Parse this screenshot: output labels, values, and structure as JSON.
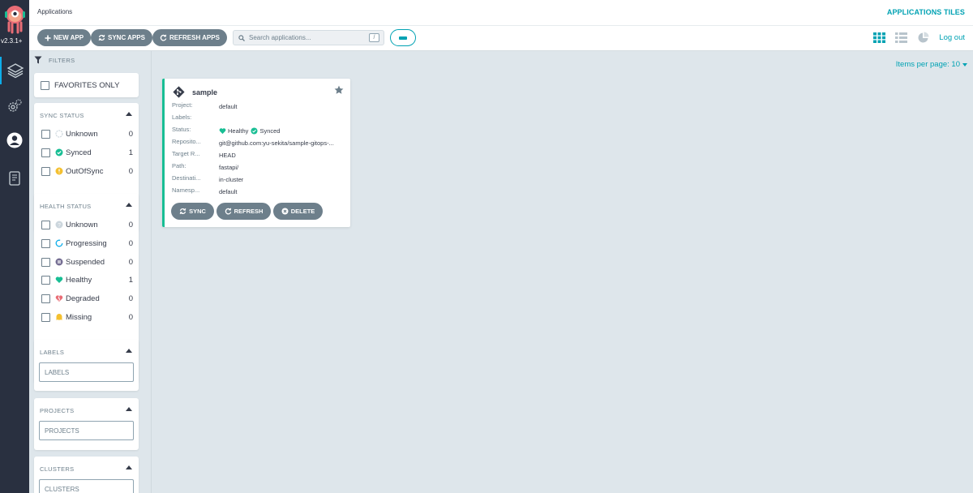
{
  "nav": {
    "version": "v2.3.1+",
    "items": [
      {
        "icon": "applications-stack-icon",
        "active": true
      },
      {
        "icon": "settings-gears-icon",
        "active": false
      },
      {
        "icon": "user-icon",
        "active": false
      },
      {
        "icon": "docs-icon",
        "active": false
      }
    ]
  },
  "topbar": {
    "title": "Applications",
    "view_title": "APPLICATIONS TILES"
  },
  "toolbar": {
    "new_app": "NEW APP",
    "sync_apps": "SYNC APPS",
    "refresh_apps": "REFRESH APPS",
    "search_placeholder": "Search applications...",
    "search_shortcut": "/",
    "logout": "Log out"
  },
  "filters": {
    "title": "FILTERS",
    "favorites": "FAVORITES ONLY",
    "sync_status": {
      "title": "SYNC STATUS",
      "items": [
        {
          "label": "Unknown",
          "count": "0"
        },
        {
          "label": "Synced",
          "count": "1"
        },
        {
          "label": "OutOfSync",
          "count": "0"
        }
      ]
    },
    "health_status": {
      "title": "HEALTH STATUS",
      "items": [
        {
          "label": "Unknown",
          "count": "0"
        },
        {
          "label": "Progressing",
          "count": "0"
        },
        {
          "label": "Suspended",
          "count": "0"
        },
        {
          "label": "Healthy",
          "count": "1"
        },
        {
          "label": "Degraded",
          "count": "0"
        },
        {
          "label": "Missing",
          "count": "0"
        }
      ]
    },
    "labels": {
      "title": "LABELS",
      "placeholder": "LABELS"
    },
    "projects": {
      "title": "PROJECTS",
      "placeholder": "PROJECTS"
    },
    "clusters": {
      "title": "CLUSTERS",
      "placeholder": "CLUSTERS"
    }
  },
  "pagination": {
    "items_per_page": "Items per page: 10"
  },
  "app": {
    "name": "sample",
    "fields": [
      {
        "key": "Project:",
        "value": "default"
      },
      {
        "key": "Labels:",
        "value": ""
      },
      {
        "key": "Status:",
        "health": "Healthy",
        "sync": "Synced"
      },
      {
        "key": "Reposito...",
        "value": "git@github.com:yu-sekita/sample-gitops-..."
      },
      {
        "key": "Target R...",
        "value": "HEAD"
      },
      {
        "key": "Path:",
        "value": "fastapi/"
      },
      {
        "key": "Destinati...",
        "value": "in-cluster"
      },
      {
        "key": "Namesp...",
        "value": "default"
      }
    ],
    "actions": {
      "sync": "SYNC",
      "refresh": "REFRESH",
      "delete": "DELETE"
    }
  },
  "colors": {
    "accent": "#00a2b3",
    "healthy": "#18be94",
    "button": "#6d7f8b",
    "nav": "#293040"
  }
}
